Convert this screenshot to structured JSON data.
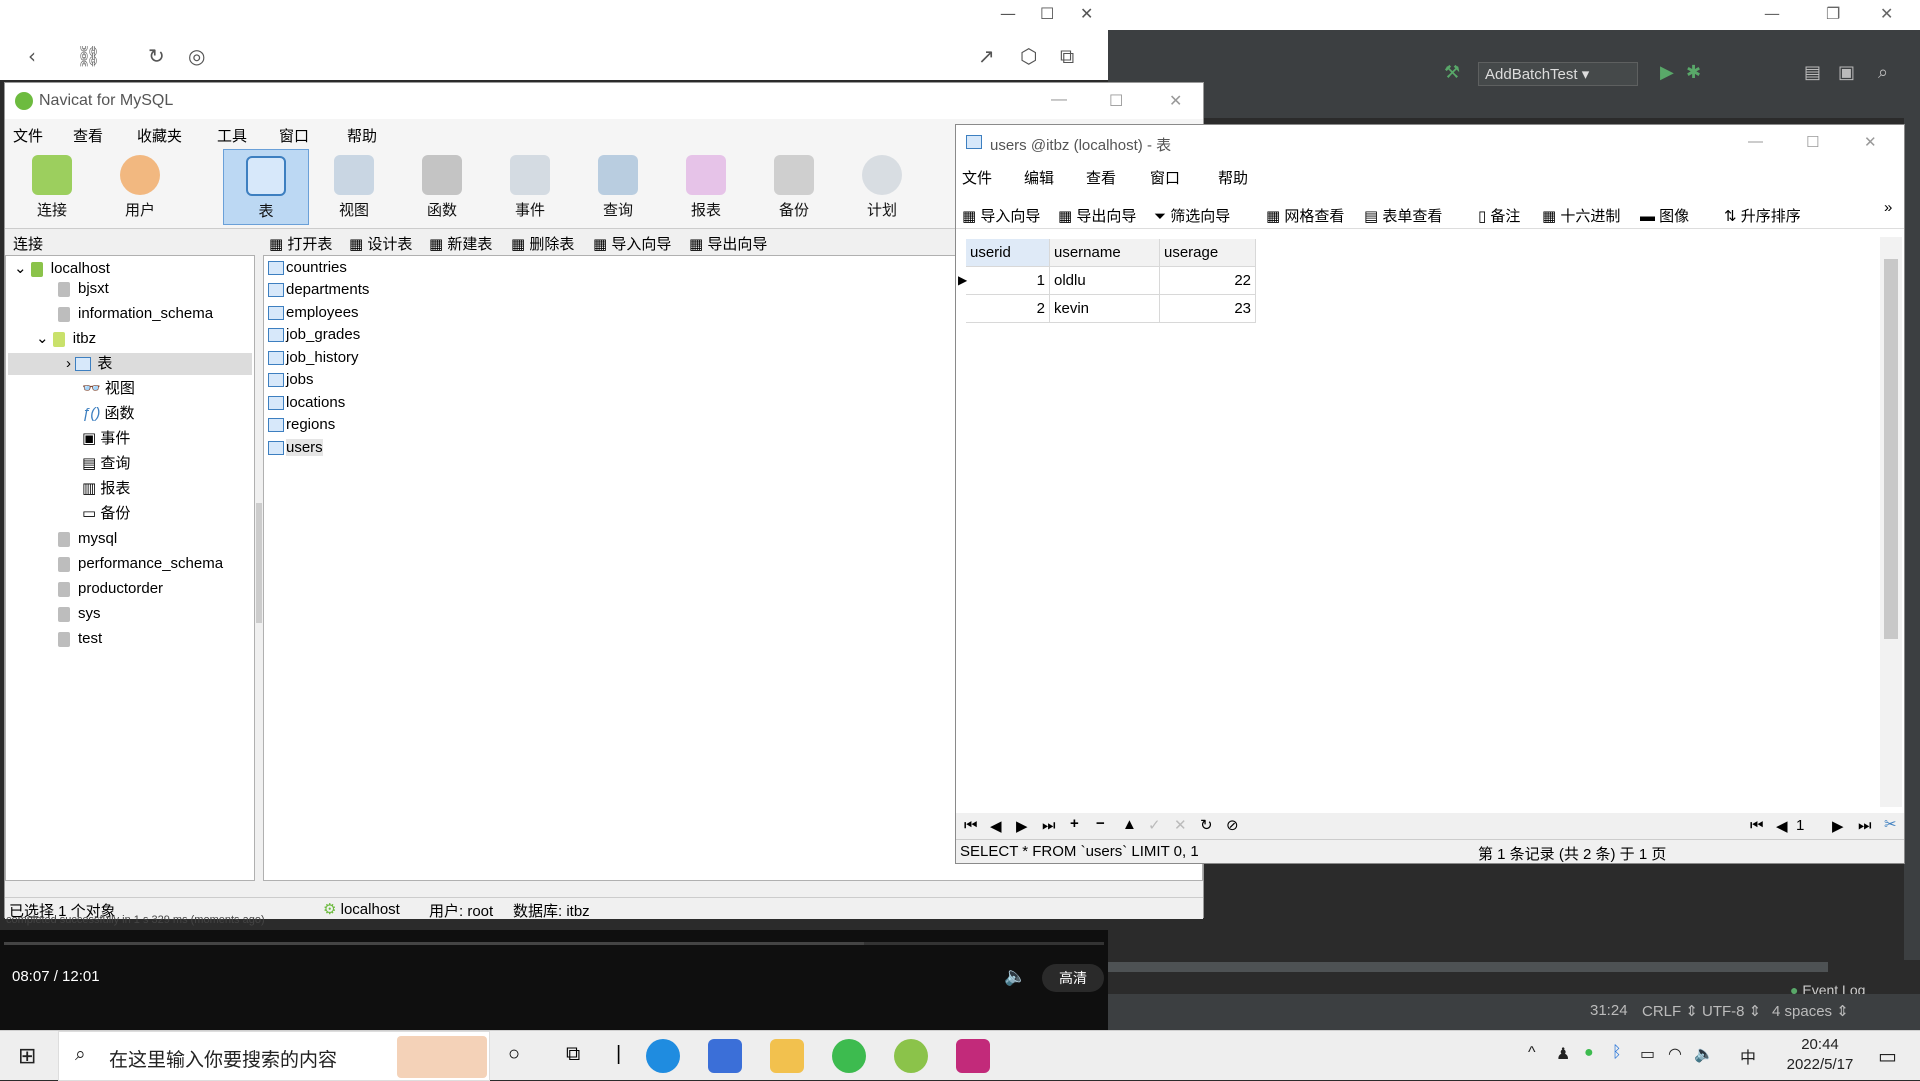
{
  "ide": {
    "run_config": "AddBatchTest",
    "event_log": "Event Log",
    "status": {
      "position": "31:24",
      "line_sep": "CRLF",
      "encoding": "UTF-8",
      "indent": "4 spaces"
    }
  },
  "video": {
    "time": "08:07 / 12:01",
    "quality": "高清",
    "message": "completed successfully in 1 s 329 ms (moments ago)"
  },
  "navicat": {
    "title": "Navicat for MySQL",
    "menu": [
      "文件",
      "查看",
      "收藏夹",
      "工具",
      "窗口",
      "帮助"
    ],
    "toolbar": [
      "连接",
      "用户",
      "表",
      "视图",
      "函数",
      "事件",
      "查询",
      "报表",
      "备份",
      "计划"
    ],
    "sub_label": "连接",
    "sub_actions": [
      "打开表",
      "设计表",
      "新建表",
      "删除表",
      "导入向导",
      "导出向导"
    ],
    "tree": {
      "root": "localhost",
      "dbs_before": [
        "bjsxt",
        "information_schema"
      ],
      "open_db": "itbz",
      "open_children": [
        "表",
        "视图",
        "函数",
        "事件",
        "查询",
        "报表",
        "备份"
      ],
      "dbs_after": [
        "mysql",
        "performance_schema",
        "productorder",
        "sys",
        "test"
      ]
    },
    "tables": [
      "countries",
      "departments",
      "employees",
      "job_grades",
      "job_history",
      "jobs",
      "locations",
      "regions",
      "users"
    ],
    "status": {
      "selected": "已选择 1 个对象",
      "host": "localhost",
      "user": "用户: root",
      "db": "数据库: itbz"
    }
  },
  "users_window": {
    "title": "users @itbz (localhost) - 表",
    "menu": [
      "文件",
      "编辑",
      "查看",
      "窗口",
      "帮助"
    ],
    "toolbar": [
      "导入向导",
      "导出向导",
      "筛选向导",
      "网格查看",
      "表单查看",
      "备注",
      "十六进制",
      "图像",
      "升序排序"
    ],
    "columns": [
      "userid",
      "username",
      "userage"
    ],
    "rows": [
      {
        "userid": "1",
        "username": "oldlu",
        "userage": "22"
      },
      {
        "userid": "2",
        "username": "kevin",
        "userage": "23"
      }
    ],
    "page": "1",
    "sql": "SELECT * FROM `users` LIMIT 0, 1",
    "record_info": "第 1 条记录 (共 2 条) 于 1 页"
  },
  "taskbar": {
    "search_placeholder": "在这里输入你要搜索的内容",
    "ime": "中",
    "time": "20:44",
    "date": "2022/5/17"
  }
}
